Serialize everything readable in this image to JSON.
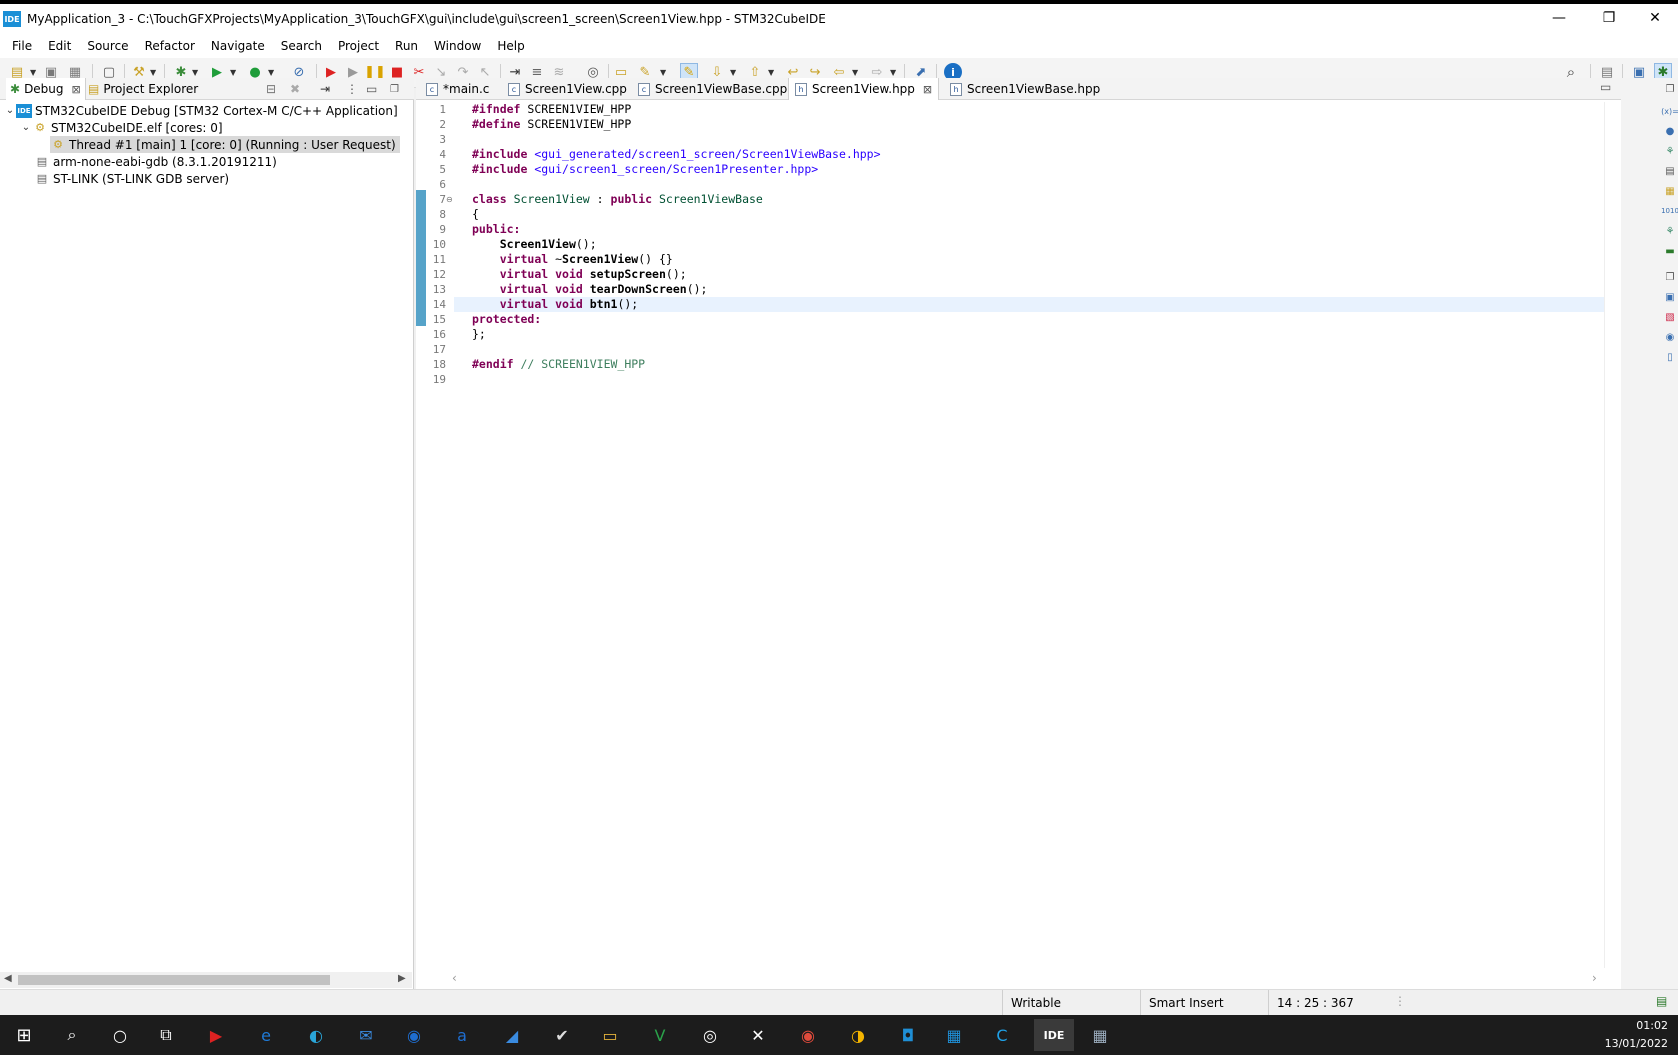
{
  "window": {
    "logo_text": "IDE",
    "title": "MyApplication_3 - C:\\TouchGFXProjects\\MyApplication_3\\TouchGFX\\gui\\include\\gui\\screen1_screen\\Screen1View.hpp - STM32CubeIDE",
    "minimize_glyph": "—",
    "restore_glyph": "❐",
    "close_glyph": "✕"
  },
  "menu": [
    "File",
    "Edit",
    "Source",
    "Refactor",
    "Navigate",
    "Search",
    "Project",
    "Run",
    "Window",
    "Help"
  ],
  "left_panel": {
    "tabs": [
      {
        "label": "Debug",
        "icon": "debug-icon",
        "close": "⊠"
      },
      {
        "label": "Project Explorer",
        "icon": "project-explorer-icon"
      }
    ],
    "tree": [
      {
        "label": "STM32CubeIDE Debug [STM32 Cortex-M C/C++ Application]",
        "icon": "launch-icon",
        "expanded": true
      },
      {
        "label": "STM32CubeIDE.elf [cores: 0]",
        "icon": "process-icon",
        "expanded": true
      },
      {
        "label": "Thread #1 [main] 1 [core: 0] (Running : User Request)",
        "icon": "thread-icon",
        "selected": true
      },
      {
        "label": "arm-none-eabi-gdb (8.3.1.20191211)",
        "icon": "gdb-icon"
      },
      {
        "label": "ST-LINK (ST-LINK GDB server)",
        "icon": "stlink-icon"
      }
    ]
  },
  "editor": {
    "tabs": [
      {
        "label": "*main.c",
        "icon": "c-file-icon",
        "active": false
      },
      {
        "label": "Screen1View.cpp",
        "icon": "cpp-file-icon",
        "active": false
      },
      {
        "label": "Screen1ViewBase.cpp",
        "icon": "cpp-file-icon",
        "active": false
      },
      {
        "label": "Screen1View.hpp",
        "icon": "h-file-icon",
        "active": true,
        "close": "⊠"
      },
      {
        "label": "Screen1ViewBase.hpp",
        "icon": "h-file-icon",
        "active": false
      }
    ],
    "line_numbers": [
      "1",
      "2",
      "3",
      "4",
      "5",
      "6",
      "7",
      "8",
      "9",
      "10",
      "11",
      "12",
      "13",
      "14",
      "15",
      "16",
      "17",
      "18",
      "19"
    ],
    "fold_marker_line": "7",
    "highlighted_line": "14",
    "lines": [
      [
        {
          "t": "#ifndef",
          "c": "kw"
        },
        {
          "t": " SCREEN1VIEW_HPP",
          "c": ""
        }
      ],
      [
        {
          "t": "#define",
          "c": "kw"
        },
        {
          "t": " SCREEN1VIEW_HPP",
          "c": ""
        }
      ],
      [],
      [
        {
          "t": "#include",
          "c": "kw"
        },
        {
          "t": " ",
          "c": ""
        },
        {
          "t": "<gui_generated/screen1_screen/Screen1ViewBase.hpp>",
          "c": "str"
        }
      ],
      [
        {
          "t": "#include",
          "c": "kw"
        },
        {
          "t": " ",
          "c": ""
        },
        {
          "t": "<gui/screen1_screen/Screen1Presenter.hpp>",
          "c": "str"
        }
      ],
      [],
      [
        {
          "t": "class",
          "c": "kw"
        },
        {
          "t": " ",
          "c": ""
        },
        {
          "t": "Screen1View",
          "c": "typ"
        },
        {
          "t": " : ",
          "c": ""
        },
        {
          "t": "public",
          "c": "kw"
        },
        {
          "t": " ",
          "c": ""
        },
        {
          "t": "Screen1ViewBase",
          "c": "typ"
        }
      ],
      [
        {
          "t": "{",
          "c": ""
        }
      ],
      [
        {
          "t": "public:",
          "c": "kw"
        }
      ],
      [
        {
          "t": "    ",
          "c": ""
        },
        {
          "t": "Screen1View",
          "c": "fn"
        },
        {
          "t": "();",
          "c": ""
        }
      ],
      [
        {
          "t": "    ",
          "c": ""
        },
        {
          "t": "virtual",
          "c": "kw"
        },
        {
          "t": " ~",
          "c": ""
        },
        {
          "t": "Screen1View",
          "c": "fn"
        },
        {
          "t": "() {}",
          "c": ""
        }
      ],
      [
        {
          "t": "    ",
          "c": ""
        },
        {
          "t": "virtual",
          "c": "kw"
        },
        {
          "t": " ",
          "c": ""
        },
        {
          "t": "void",
          "c": "kw"
        },
        {
          "t": " ",
          "c": ""
        },
        {
          "t": "setupScreen",
          "c": "fn"
        },
        {
          "t": "();",
          "c": ""
        }
      ],
      [
        {
          "t": "    ",
          "c": ""
        },
        {
          "t": "virtual",
          "c": "kw"
        },
        {
          "t": " ",
          "c": ""
        },
        {
          "t": "void",
          "c": "kw"
        },
        {
          "t": " ",
          "c": ""
        },
        {
          "t": "tearDownScreen",
          "c": "fn"
        },
        {
          "t": "();",
          "c": ""
        }
      ],
      [
        {
          "t": "    ",
          "c": ""
        },
        {
          "t": "virtual",
          "c": "kw"
        },
        {
          "t": " ",
          "c": ""
        },
        {
          "t": "void",
          "c": "kw"
        },
        {
          "t": " ",
          "c": ""
        },
        {
          "t": "btn1",
          "c": "fn"
        },
        {
          "t": "();",
          "c": ""
        }
      ],
      [
        {
          "t": "protected:",
          "c": "kw"
        }
      ],
      [
        {
          "t": "};",
          "c": ""
        }
      ],
      [],
      [
        {
          "t": "#endif",
          "c": "kw"
        },
        {
          "t": " ",
          "c": ""
        },
        {
          "t": "// SCREEN1VIEW_HPP",
          "c": "cmt"
        }
      ],
      []
    ]
  },
  "status": {
    "writable": "Writable",
    "insert_mode": "Smart Insert",
    "position": "14 : 25 : 367"
  },
  "taskbar": {
    "time": "01:02",
    "date": "13/01/2022",
    "ide_label": "IDE"
  },
  "colors": {
    "keyword": "#7f0055",
    "string": "#2a00ff",
    "comment": "#3f7f5f",
    "type": "#005032",
    "line_highlight": "#e8f2fe",
    "selection": "#d4d4d4",
    "accent": "#1a8fd6"
  }
}
